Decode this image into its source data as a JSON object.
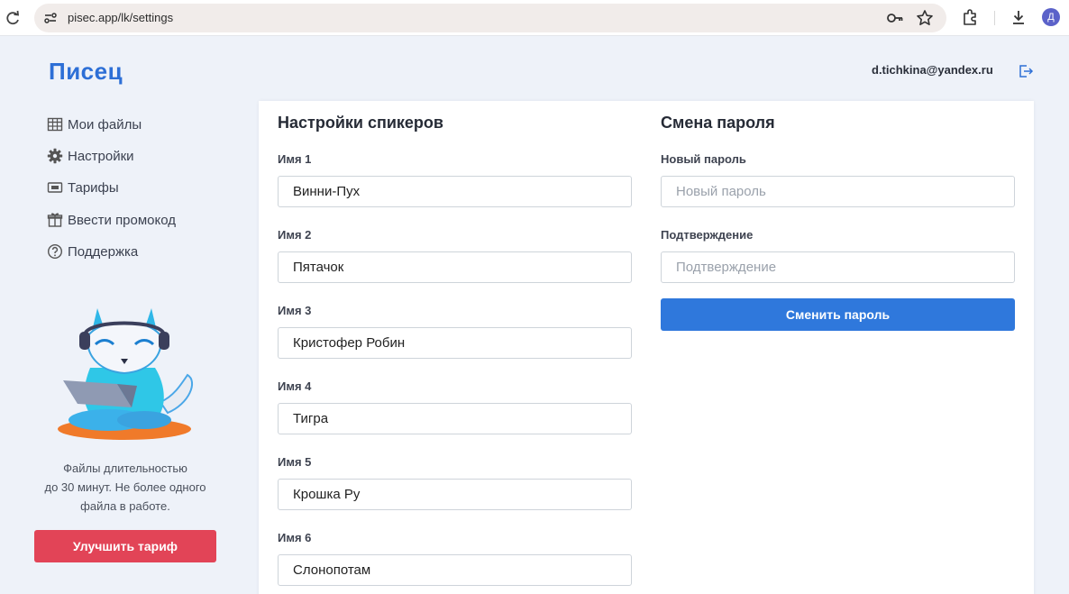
{
  "browser": {
    "url": "pisec.app/lk/settings",
    "profile_initial": "Д"
  },
  "header": {
    "logo": "Писец",
    "email": "d.tichkina@yandex.ru"
  },
  "sidebar": {
    "items": [
      {
        "label": "Мои файлы",
        "icon": "table-icon"
      },
      {
        "label": "Настройки",
        "icon": "gear-icon"
      },
      {
        "label": "Тарифы",
        "icon": "ticket-icon"
      },
      {
        "label": "Ввести промокод",
        "icon": "gift-icon"
      },
      {
        "label": "Поддержка",
        "icon": "question-icon"
      }
    ],
    "plan_note_lines": [
      "Файлы длительностью",
      "до 30 минут. Не более одного",
      "файла в работе."
    ],
    "upgrade_label": "Улучшить тариф"
  },
  "speakers": {
    "title": "Настройки спикеров",
    "fields": [
      {
        "label": "Имя 1",
        "value": "Винни-Пух"
      },
      {
        "label": "Имя 2",
        "value": "Пятачок"
      },
      {
        "label": "Имя 3",
        "value": "Кристофер Робин"
      },
      {
        "label": "Имя 4",
        "value": "Тигра"
      },
      {
        "label": "Имя 5",
        "value": "Крошка Ру"
      },
      {
        "label": "Имя 6",
        "value": "Слонопотам"
      }
    ]
  },
  "password": {
    "title": "Смена пароля",
    "new_label": "Новый пароль",
    "new_placeholder": "Новый пароль",
    "confirm_label": "Подтверждение",
    "confirm_placeholder": "Подтверждение",
    "submit_label": "Сменить пароль"
  },
  "colors": {
    "brand": "#2d6fd6",
    "primary_button": "#2f78dc",
    "upgrade_button": "#e24457"
  }
}
